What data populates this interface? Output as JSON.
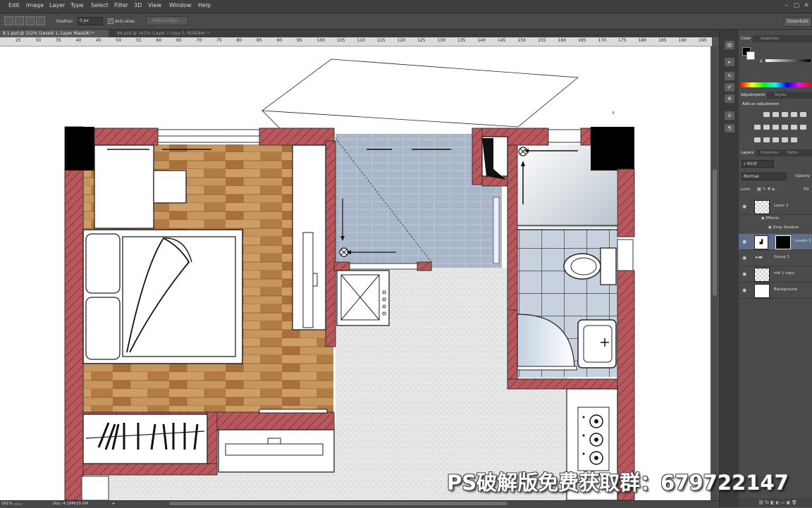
{
  "menu": [
    "Edit",
    "Image",
    "Layer",
    "Type",
    "Select",
    "Filter",
    "3D",
    "View",
    "Window",
    "Help"
  ],
  "options_bar": {
    "feather_label": "Feather:",
    "feather_value": "0 px",
    "antialias_label": "Anti-alias",
    "refine_edge_label": "Refine Edge...",
    "essentials_label": "Essentials"
  },
  "doc_tabs": [
    {
      "label": "8 1.psd @ 152% (Levels 1, Layer Mask/8) *",
      "active": true
    },
    {
      "label": "88.psd @ 161% (Layer 1 copy 5, RGB/8#) *",
      "active": false
    }
  ],
  "ruler_top": [
    "25",
    "30",
    "35",
    "40",
    "45",
    "50",
    "55",
    "60",
    "65",
    "70",
    "75",
    "80",
    "85",
    "90",
    "95",
    "100",
    "105",
    "110",
    "115",
    "120",
    "125",
    "130",
    "135",
    "140",
    "145",
    "150",
    "155",
    "160",
    "165",
    "170",
    "175",
    "180",
    "185",
    "190",
    "195"
  ],
  "status": {
    "zoom": "161%",
    "doc": "Doc: 4.19M/15.0M"
  },
  "color_panel": {
    "tabs": [
      "Color",
      "Swatches"
    ],
    "k_label": "K"
  },
  "adjustments_panel": {
    "tabs": [
      "Adjustments",
      "Styles"
    ],
    "title": "Add an adjustment"
  },
  "layers_panel": {
    "tabs": [
      "Layers",
      "Channels",
      "Paths"
    ],
    "kind_label": "Kind",
    "blend_mode": "Normal",
    "opacity_label": "Opacity",
    "lock_label": "Lock:",
    "fill_label": "Fill",
    "layers": [
      {
        "name": "Layer 1",
        "thumb": "checker"
      },
      {
        "name": "Effects",
        "sub": true
      },
      {
        "name": "Drop Shadow",
        "sub": true
      },
      {
        "name": "Levels 1",
        "thumb": "levels",
        "selected": true
      },
      {
        "name": "Group 1",
        "thumb": "folder"
      },
      {
        "name": "mb 1 copy",
        "thumb": "checker"
      },
      {
        "name": "Background",
        "thumb": "white"
      }
    ]
  },
  "watermark": "PS破解版免费获取群：679722147",
  "colors": {
    "wall": "#b8575c",
    "wall_dark": "#8a3a3f",
    "wood": "#c08a52",
    "tile": "#b7c3d3",
    "floor": "#e6e6e6"
  }
}
